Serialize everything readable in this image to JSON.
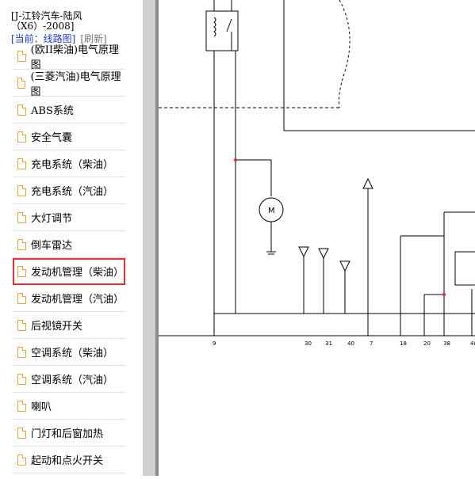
{
  "sidebar": {
    "title": "[J-江铃汽车-陆风\n（X6）-2008]",
    "current_prefix": "[当前：线路图]",
    "refresh": "[刷新]",
    "items": [
      {
        "label": "(欧II柴油)电气原理图"
      },
      {
        "label": "(三菱汽油)电气原理图"
      },
      {
        "label": "ABS系统"
      },
      {
        "label": "安全气囊"
      },
      {
        "label": "充电系统（柴油）"
      },
      {
        "label": "充电系统（汽油）"
      },
      {
        "label": "大灯调节"
      },
      {
        "label": "倒车雷达"
      },
      {
        "label": "发动机管理（柴油）"
      },
      {
        "label": "发动机管理（汽油）"
      },
      {
        "label": "后视镜开关"
      },
      {
        "label": "空调系统（柴油）"
      },
      {
        "label": "空调系统（汽油）"
      },
      {
        "label": "喇叭"
      },
      {
        "label": "门灯和后窗加热"
      },
      {
        "label": "起动和点火开关"
      }
    ],
    "active_index": 8
  },
  "diagram": {
    "pin_numbers": [
      "9",
      "30",
      "31",
      "40",
      "7",
      "18",
      "20",
      "38",
      "40"
    ]
  }
}
